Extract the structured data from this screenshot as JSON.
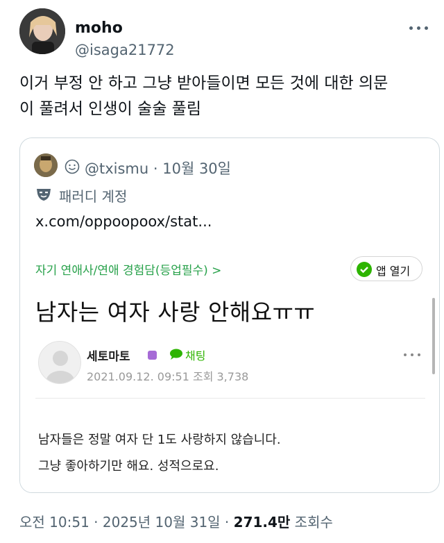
{
  "author": {
    "name": "moho",
    "handle": "@isaga21772"
  },
  "tweet": {
    "line1": "이거 부정 안 하고 그냥 받아들이면 모든 것에 대한 의문",
    "line2": "이 풀려서 인생이 술술 풀림"
  },
  "quote": {
    "handle_date": "@txismu · 10월 30일",
    "parody_label": "패러디 계정",
    "link_text": "x.com/oppoopoox/stat...",
    "embedded": {
      "breadcrumb": "자기 연애사/연애 경험담(등업필수) >",
      "app_button": "앱 열기",
      "title": "남자는 여자 사랑 안해요ㅠㅠ",
      "author_name": "세토마토",
      "chat_label": "채팅",
      "meta": "2021.09.12. 09:51  조회 3,738",
      "body_line1": "남자들은 정말 여자 단 1도 사랑하지 않습니다.",
      "body_line2": "그냥 좋아하기만 해요. 성적으로요."
    }
  },
  "footer": {
    "time_date": "오전 10:51 · 2025년 10월 31일 · ",
    "views_count": "271.4만",
    "views_label": " 조회수"
  },
  "colors": {
    "secondary_text": "#536471",
    "naver_green": "#2db400",
    "border": "#cfd9de"
  }
}
